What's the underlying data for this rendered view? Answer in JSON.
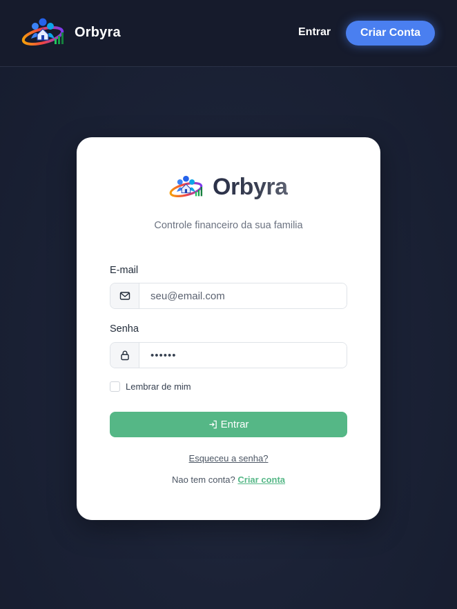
{
  "navbar": {
    "brand_name": "Orbyra",
    "login_label": "Entrar",
    "signup_label": "Criar Conta"
  },
  "card": {
    "brand_name": "Orbyra",
    "subtitle": "Controle financeiro da sua familia",
    "email": {
      "label": "E-mail",
      "placeholder": "seu@email.com",
      "icon": "mail-icon"
    },
    "password": {
      "label": "Senha",
      "value": "••••••",
      "icon": "lock-icon"
    },
    "remember_label": "Lembrar de mim",
    "remember_checked": false,
    "submit_label": "Entrar",
    "submit_icon": "login-icon",
    "forgot_label": "Esqueceu a senha?",
    "no_account_text": "Nao tem conta?",
    "create_account_label": "Criar conta"
  },
  "colors": {
    "background": "#1b2236",
    "accent_blue": "#4a7ff0",
    "accent_green": "#55b786",
    "card": "#ffffff"
  }
}
